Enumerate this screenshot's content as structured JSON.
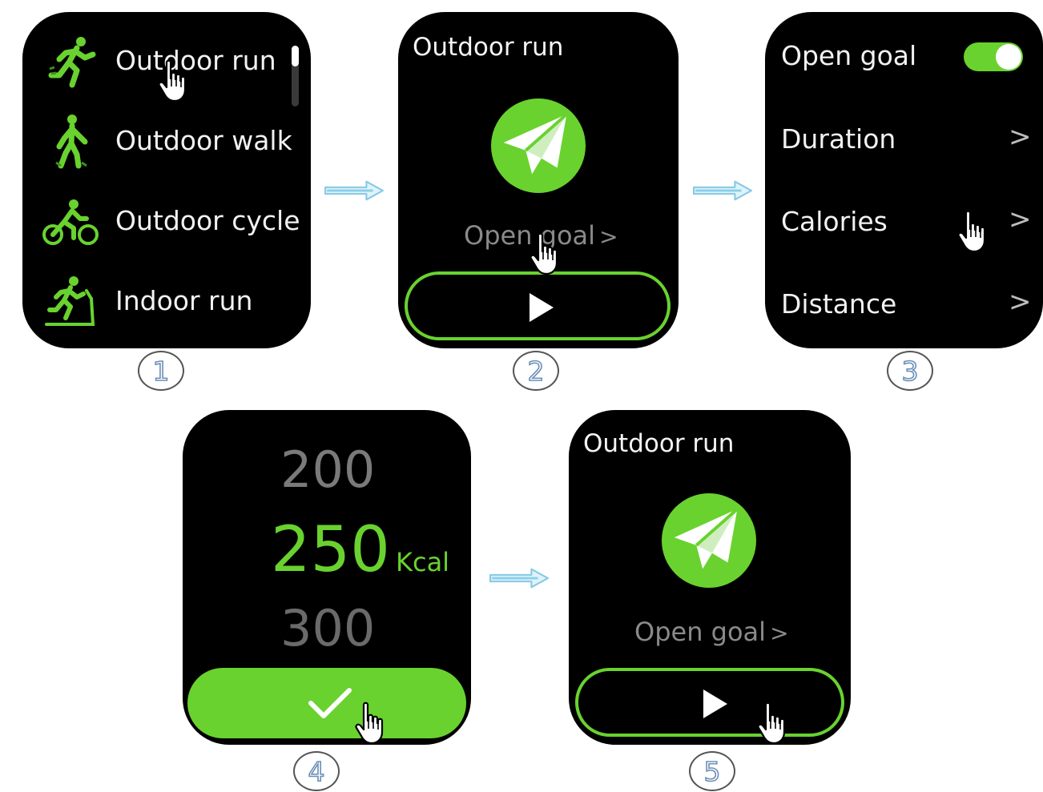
{
  "colors": {
    "accent": "#69d22f",
    "screen_bg": "#000000",
    "arrow": "#9fd8ef"
  },
  "step1": {
    "number": "1",
    "items": [
      {
        "label": "Outdoor run",
        "icon": "running-icon"
      },
      {
        "label": "Outdoor walk",
        "icon": "walking-icon"
      },
      {
        "label": "Outdoor cycle",
        "icon": "cycling-icon"
      },
      {
        "label": "Indoor run",
        "icon": "treadmill-icon"
      }
    ]
  },
  "step2": {
    "number": "2",
    "title": "Outdoor run",
    "goal_label": "Open goal",
    "chevron": ">"
  },
  "step3": {
    "number": "3",
    "toggle_label": "Open goal",
    "toggle_on": true,
    "items": [
      {
        "label": "Duration",
        "chevron": ">"
      },
      {
        "label": "Calories",
        "chevron": ">"
      },
      {
        "label": "Distance",
        "chevron": ">"
      }
    ]
  },
  "step4": {
    "number": "4",
    "prev_value": "200",
    "selected_value": "250",
    "unit": "Kcal",
    "next_value": "300"
  },
  "step5": {
    "number": "5",
    "title": "Outdoor run",
    "goal_label": "Open goal",
    "chevron": ">"
  }
}
